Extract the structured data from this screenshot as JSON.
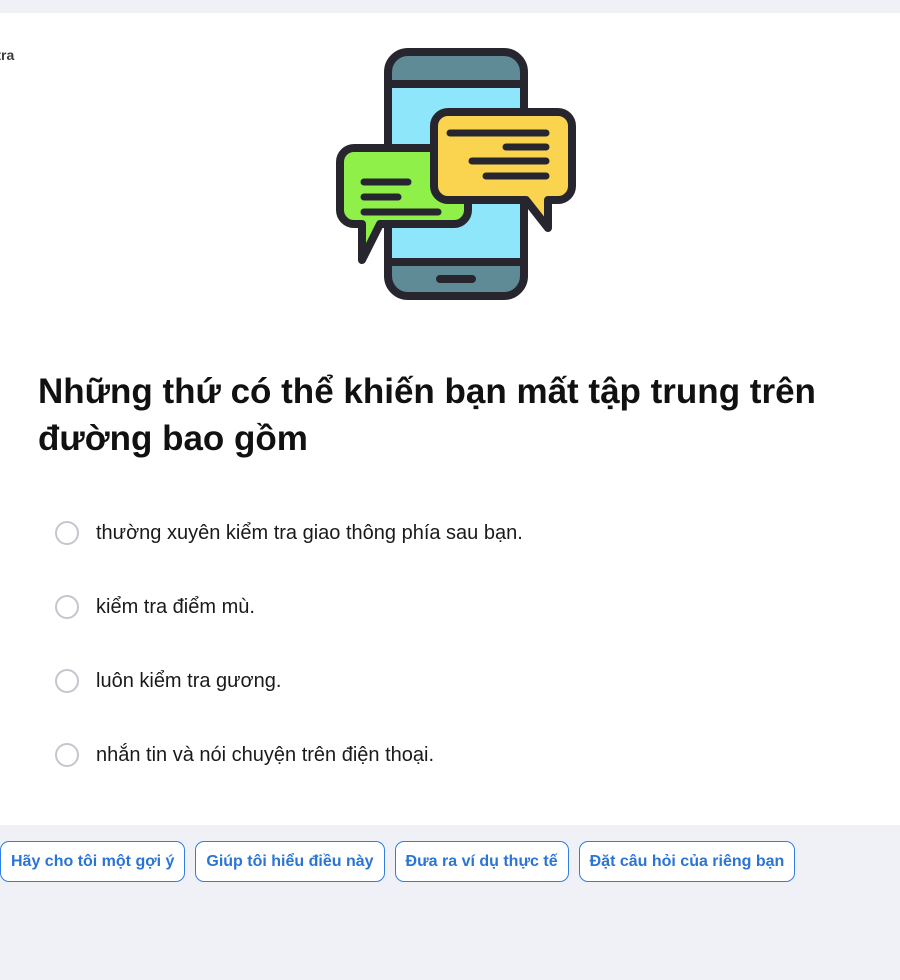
{
  "card": {
    "label": "m tra"
  },
  "illustration": {
    "icon": "phone-chat-icon"
  },
  "question": "Những thứ có thể khiến bạn mất tập trung trên đường bao gồm",
  "options": [
    {
      "text": "thường xuyên kiểm tra giao thông phía sau bạn.",
      "selected": false
    },
    {
      "text": "kiểm tra điểm mù.",
      "selected": false
    },
    {
      "text": "luôn kiểm tra gương.",
      "selected": false
    },
    {
      "text": "nhắn tin và nói chuyện trên điện thoại.",
      "selected": false
    }
  ],
  "actions": [
    "Hãy cho tôi một gợi ý",
    "Giúp tôi hiểu điều này",
    "Đưa ra ví dụ thực tế",
    "Đặt câu hỏi của riêng bạn"
  ],
  "colors": {
    "background": "#f0f1f6",
    "accent": "#2f7ee0",
    "bubble_green": "#8ff04a",
    "bubble_yellow": "#fbd44f",
    "screen": "#8ee6fb"
  }
}
